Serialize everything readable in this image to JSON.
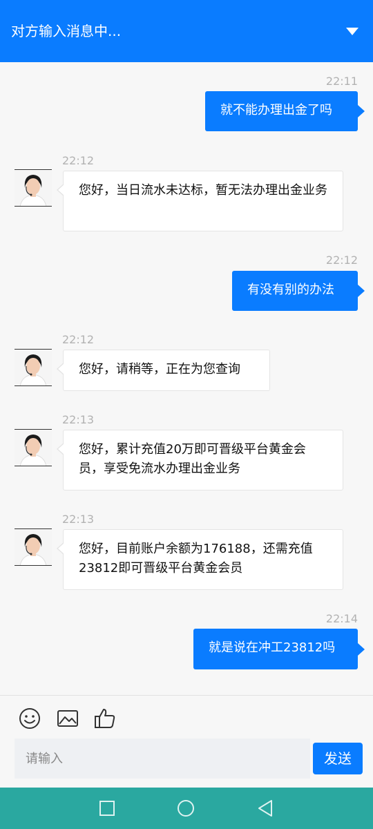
{
  "header": {
    "title": "对方输入消息中..."
  },
  "messages": [
    {
      "time": "22:11",
      "dir": "out",
      "text": "就不能办理出金了吗"
    },
    {
      "time": "22:12",
      "dir": "in",
      "text": "您好，当日流水未达标，暂无法办理出金业务"
    },
    {
      "time": "22:12",
      "dir": "out",
      "text": "有没有别的办法"
    },
    {
      "time": "22:12",
      "dir": "in",
      "text": "您好，请稍等，正在为您查询"
    },
    {
      "time": "22:13",
      "dir": "in",
      "text": "您好，累计充值20万即可晋级平台黄金会员，享受免流水办理出金业务"
    },
    {
      "time": "22:13",
      "dir": "in",
      "text": "您好，目前账户余额为176188，还需充值23812即可晋级平台黄金会员"
    },
    {
      "time": "22:14",
      "dir": "out",
      "text": "就是说在冲工23812吗"
    }
  ],
  "composer": {
    "placeholder": "请输入",
    "send_label": "发送"
  },
  "colors": {
    "accent": "#0a7cff",
    "navbar": "#2aa8a0"
  },
  "icons": [
    "emoji-icon",
    "image-icon",
    "thumbs-up-icon",
    "square-nav-icon",
    "circle-nav-icon",
    "back-nav-icon"
  ]
}
